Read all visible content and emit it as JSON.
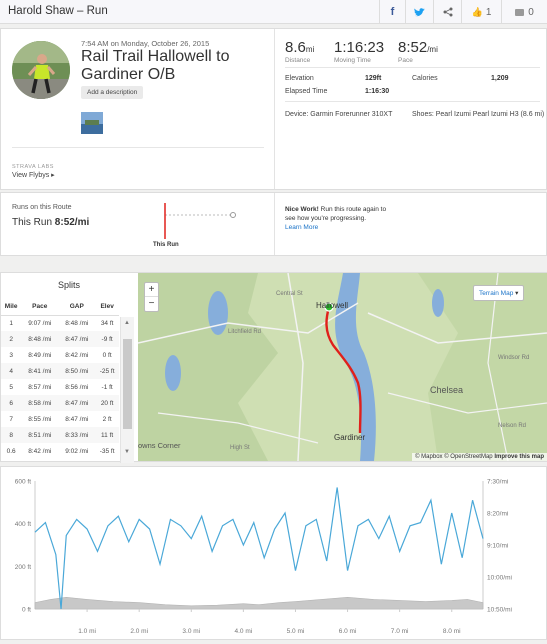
{
  "header": {
    "title": "Harold Shaw – Run",
    "kudos": "1",
    "comments": "0"
  },
  "activity": {
    "datetime": "7:54 AM on Monday, October 26, 2015",
    "name_line1": "Rail Trail Hallowell to",
    "name_line2": "Gardiner O/B",
    "description_button": "Add a description",
    "labs": "STRAVA LABS",
    "flyby": "View Flybys ▸"
  },
  "stats": {
    "distance": {
      "value": "8.6",
      "unit": "mi",
      "label": "Distance"
    },
    "moving_time": {
      "value": "1:16:23",
      "label": "Moving Time"
    },
    "pace": {
      "value": "8:52",
      "unit": "/mi",
      "label": "Pace"
    },
    "elevation_label": "Elevation",
    "elevation_value": "129ft",
    "calories_label": "Calories",
    "calories_value": "1,209",
    "elapsed_label": "Elapsed Time",
    "elapsed_value": "1:16:30",
    "device": "Device: Garmin Forerunner 310XT",
    "shoes": "Shoes: Pearl Izumi Pearl Izumi H3 (8.6 mi)"
  },
  "route": {
    "title": "Runs on this Route",
    "this_run_label": "This Run",
    "this_run_value": "8:52/mi",
    "marker_label": "This Run",
    "nice_bold": "Nice Work!",
    "nice_text": " Run this route again to",
    "nice_text2": "see how you're progressing.",
    "learn_more": "Learn More"
  },
  "splits": {
    "title": "Splits",
    "headers": [
      "Mile",
      "Pace",
      "GAP",
      "Elev"
    ],
    "rows": [
      [
        "1",
        "9:07 /mi",
        "8:48 /mi",
        "34 ft"
      ],
      [
        "2",
        "8:48 /mi",
        "8:47 /mi",
        "-9 ft"
      ],
      [
        "3",
        "8:49 /mi",
        "8:42 /mi",
        "0 ft"
      ],
      [
        "4",
        "8:41 /mi",
        "8:50 /mi",
        "-25 ft"
      ],
      [
        "5",
        "8:57 /mi",
        "8:56 /mi",
        "-1 ft"
      ],
      [
        "6",
        "8:58 /mi",
        "8:47 /mi",
        "20 ft"
      ],
      [
        "7",
        "8:55 /mi",
        "8:47 /mi",
        "2 ft"
      ],
      [
        "8",
        "8:51 /mi",
        "8:33 /mi",
        "11 ft"
      ],
      [
        "0.6",
        "8:42 /mi",
        "9:02 /mi",
        "-35 ft"
      ]
    ]
  },
  "map": {
    "terrain_button": "Terrain Map",
    "zoom_in": "+",
    "zoom_out": "−",
    "attribution": "© Mapbox © OpenStreetMap",
    "improve": "Improve this map",
    "places": {
      "hallowell": "Hallowell",
      "gardiner": "Gardiner",
      "chelsea": "Chelsea",
      "browns": "owns Corner",
      "central": "Central St",
      "litchfield": "Litchfield Rd",
      "high": "High St",
      "nelson": "Nelson Rd",
      "windsor": "Windsor Rd"
    }
  },
  "chart_data": {
    "type": "line",
    "xlabel": "",
    "ylabel": "",
    "x_ticks": [
      "1.0 mi",
      "2.0 mi",
      "3.0 mi",
      "4.0 mi",
      "5.0 mi",
      "6.0 mi",
      "7.0 mi",
      "8.0 mi"
    ],
    "y_left_ticks": [
      "600 ft",
      "400 ft",
      "200 ft",
      "0 ft"
    ],
    "y_left_range": [
      0,
      600
    ],
    "y_right_ticks": [
      "7:30/mi",
      "8:20/mi",
      "9:10/mi",
      "10:00/mi",
      "10:50/mi"
    ],
    "distance_range": [
      0,
      8.6
    ],
    "series": [
      {
        "name": "",
        "kind": "elevation",
        "color": "#c8c8c8",
        "x": [
          0,
          0.3,
          0.6,
          1.0,
          1.5,
          2.0,
          2.5,
          3.0,
          3.5,
          4.0,
          4.3,
          4.7,
          5.0,
          5.5,
          6.0,
          6.5,
          7.0,
          7.5,
          8.0,
          8.3,
          8.6
        ],
        "values": [
          30,
          45,
          55,
          45,
          35,
          30,
          20,
          15,
          18,
          25,
          20,
          30,
          35,
          45,
          55,
          45,
          40,
          35,
          40,
          45,
          30
        ]
      },
      {
        "name": "",
        "kind": "pace",
        "color": "#4aa8d8",
        "x": [
          0,
          0.2,
          0.4,
          0.5,
          0.6,
          0.8,
          1.0,
          1.2,
          1.4,
          1.6,
          1.8,
          2.0,
          2.2,
          2.4,
          2.6,
          2.8,
          3.0,
          3.2,
          3.4,
          3.6,
          3.8,
          4.0,
          4.2,
          4.4,
          4.6,
          4.8,
          5.0,
          5.2,
          5.4,
          5.6,
          5.8,
          6.0,
          6.2,
          6.4,
          6.6,
          6.8,
          7.0,
          7.2,
          7.4,
          7.6,
          7.8,
          8.0,
          8.2,
          8.4,
          8.6
        ],
        "values": [
          "8:50",
          "8:35",
          "9:25",
          "10:50",
          "8:55",
          "8:30",
          "8:45",
          "9:20",
          "8:40",
          "8:25",
          "9:05",
          "8:30",
          "8:45",
          "9:40",
          "8:30",
          "8:40",
          "9:00",
          "8:25",
          "9:20",
          "8:40",
          "8:30",
          "9:10",
          "8:35",
          "9:30",
          "8:45",
          "8:20",
          "9:50",
          "8:40",
          "8:30",
          "9:35",
          "7:40",
          "9:50",
          "8:40",
          "8:30",
          "9:00",
          "8:25",
          "9:20",
          "8:40",
          "8:35",
          "8:00",
          "9:40",
          "8:20",
          "9:30",
          "8:00",
          "9:00"
        ]
      }
    ]
  },
  "colors": {
    "strava_orange": "#fc4c02",
    "route_red": "#e0201b",
    "start_green": "#2bbd2b",
    "link_blue": "#1a73c8",
    "pace_blue": "#4aa8d8"
  }
}
